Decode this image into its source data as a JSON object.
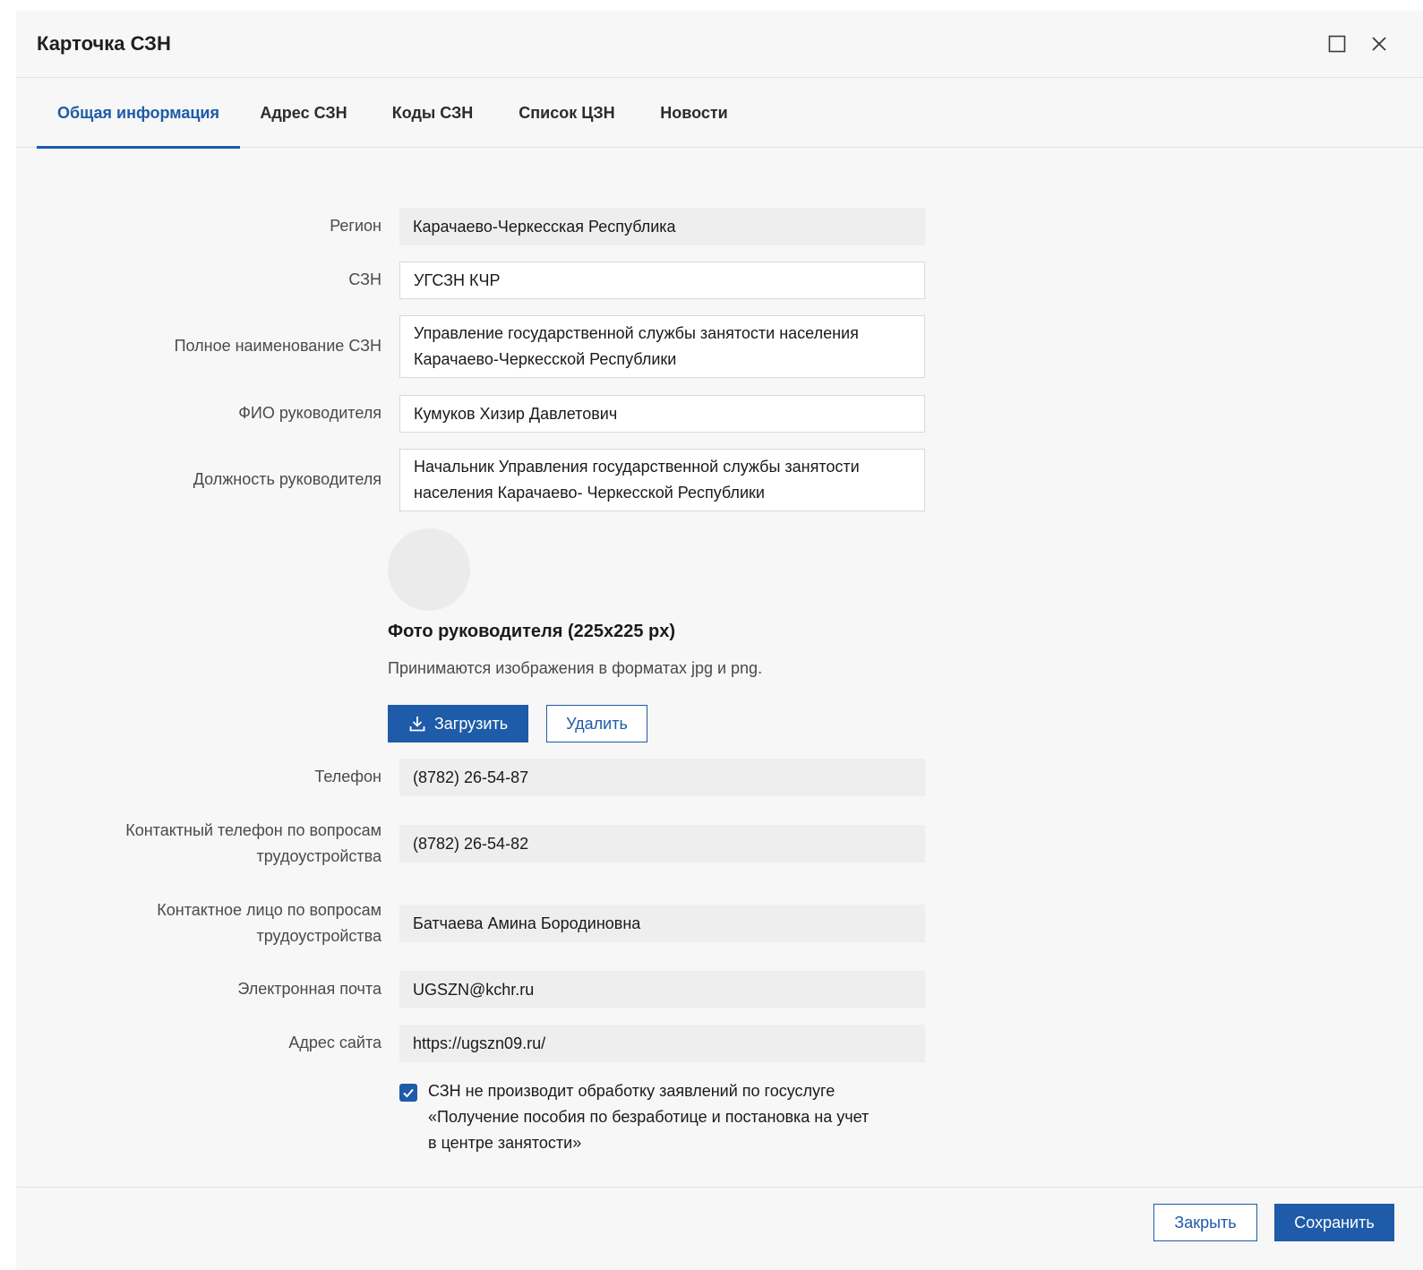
{
  "modal": {
    "title": "Карточка СЗН",
    "maximize_icon": "maximize-icon",
    "close_icon": "close-icon"
  },
  "tabs": [
    {
      "label": "Общая информация",
      "active": true
    },
    {
      "label": "Адрес СЗН",
      "active": false
    },
    {
      "label": "Коды СЗН",
      "active": false
    },
    {
      "label": "Список ЦЗН",
      "active": false
    },
    {
      "label": "Новости",
      "active": false
    }
  ],
  "form": {
    "region": {
      "label": "Регион",
      "value": "Карачаево-Черкесская Республика"
    },
    "szn": {
      "label": "СЗН",
      "value": "УГСЗН КЧР"
    },
    "full_name": {
      "label": "Полное наименование СЗН",
      "value_line1": "Управление государственной службы занятости населения",
      "value_line2": "Карачаево-Черкесской Республики"
    },
    "head_name": {
      "label": "ФИО руководителя",
      "value": "Кумуков Хизир Давлетович"
    },
    "head_position": {
      "label": "Должность руководителя",
      "value_line1": "Начальник Управления государственной службы занятости",
      "value_line2": "населения Карачаево- Черкесской Республики"
    },
    "photo": {
      "title": "Фото руководителя (225x225 px)",
      "hint": "Принимаются изображения в форматах jpg и png.",
      "upload_label": "Загрузить",
      "upload_icon": "download-icon",
      "delete_label": "Удалить"
    },
    "phone": {
      "label": "Телефон",
      "value": "(8782) 26-54-87"
    },
    "job_phone": {
      "label_line1": "Контактный телефон по вопросам",
      "label_line2": "трудоустройства",
      "value": "(8782) 26-54-82"
    },
    "job_contact": {
      "label_line1": "Контактное лицо по вопросам",
      "label_line2": "трудоустройства",
      "value": "Батчаева Амина Бородиновна"
    },
    "email": {
      "label": "Электронная почта",
      "value": "UGSZN@kchr.ru"
    },
    "website": {
      "label": "Адрес сайта",
      "value": "https://ugszn09.ru/"
    },
    "no_processing": {
      "checked": true,
      "label_line1": "СЗН не производит обработку заявлений по госуслуге",
      "label_line2": "«Получение пособия по безработице и постановка на учет",
      "label_line3": "в центре занятости»"
    }
  },
  "footer": {
    "close_label": "Закрыть",
    "save_label": "Сохранить"
  },
  "colors": {
    "accent": "#1e5ba8",
    "background": "#f7f7f7",
    "readonly_field": "#eeeeee"
  }
}
